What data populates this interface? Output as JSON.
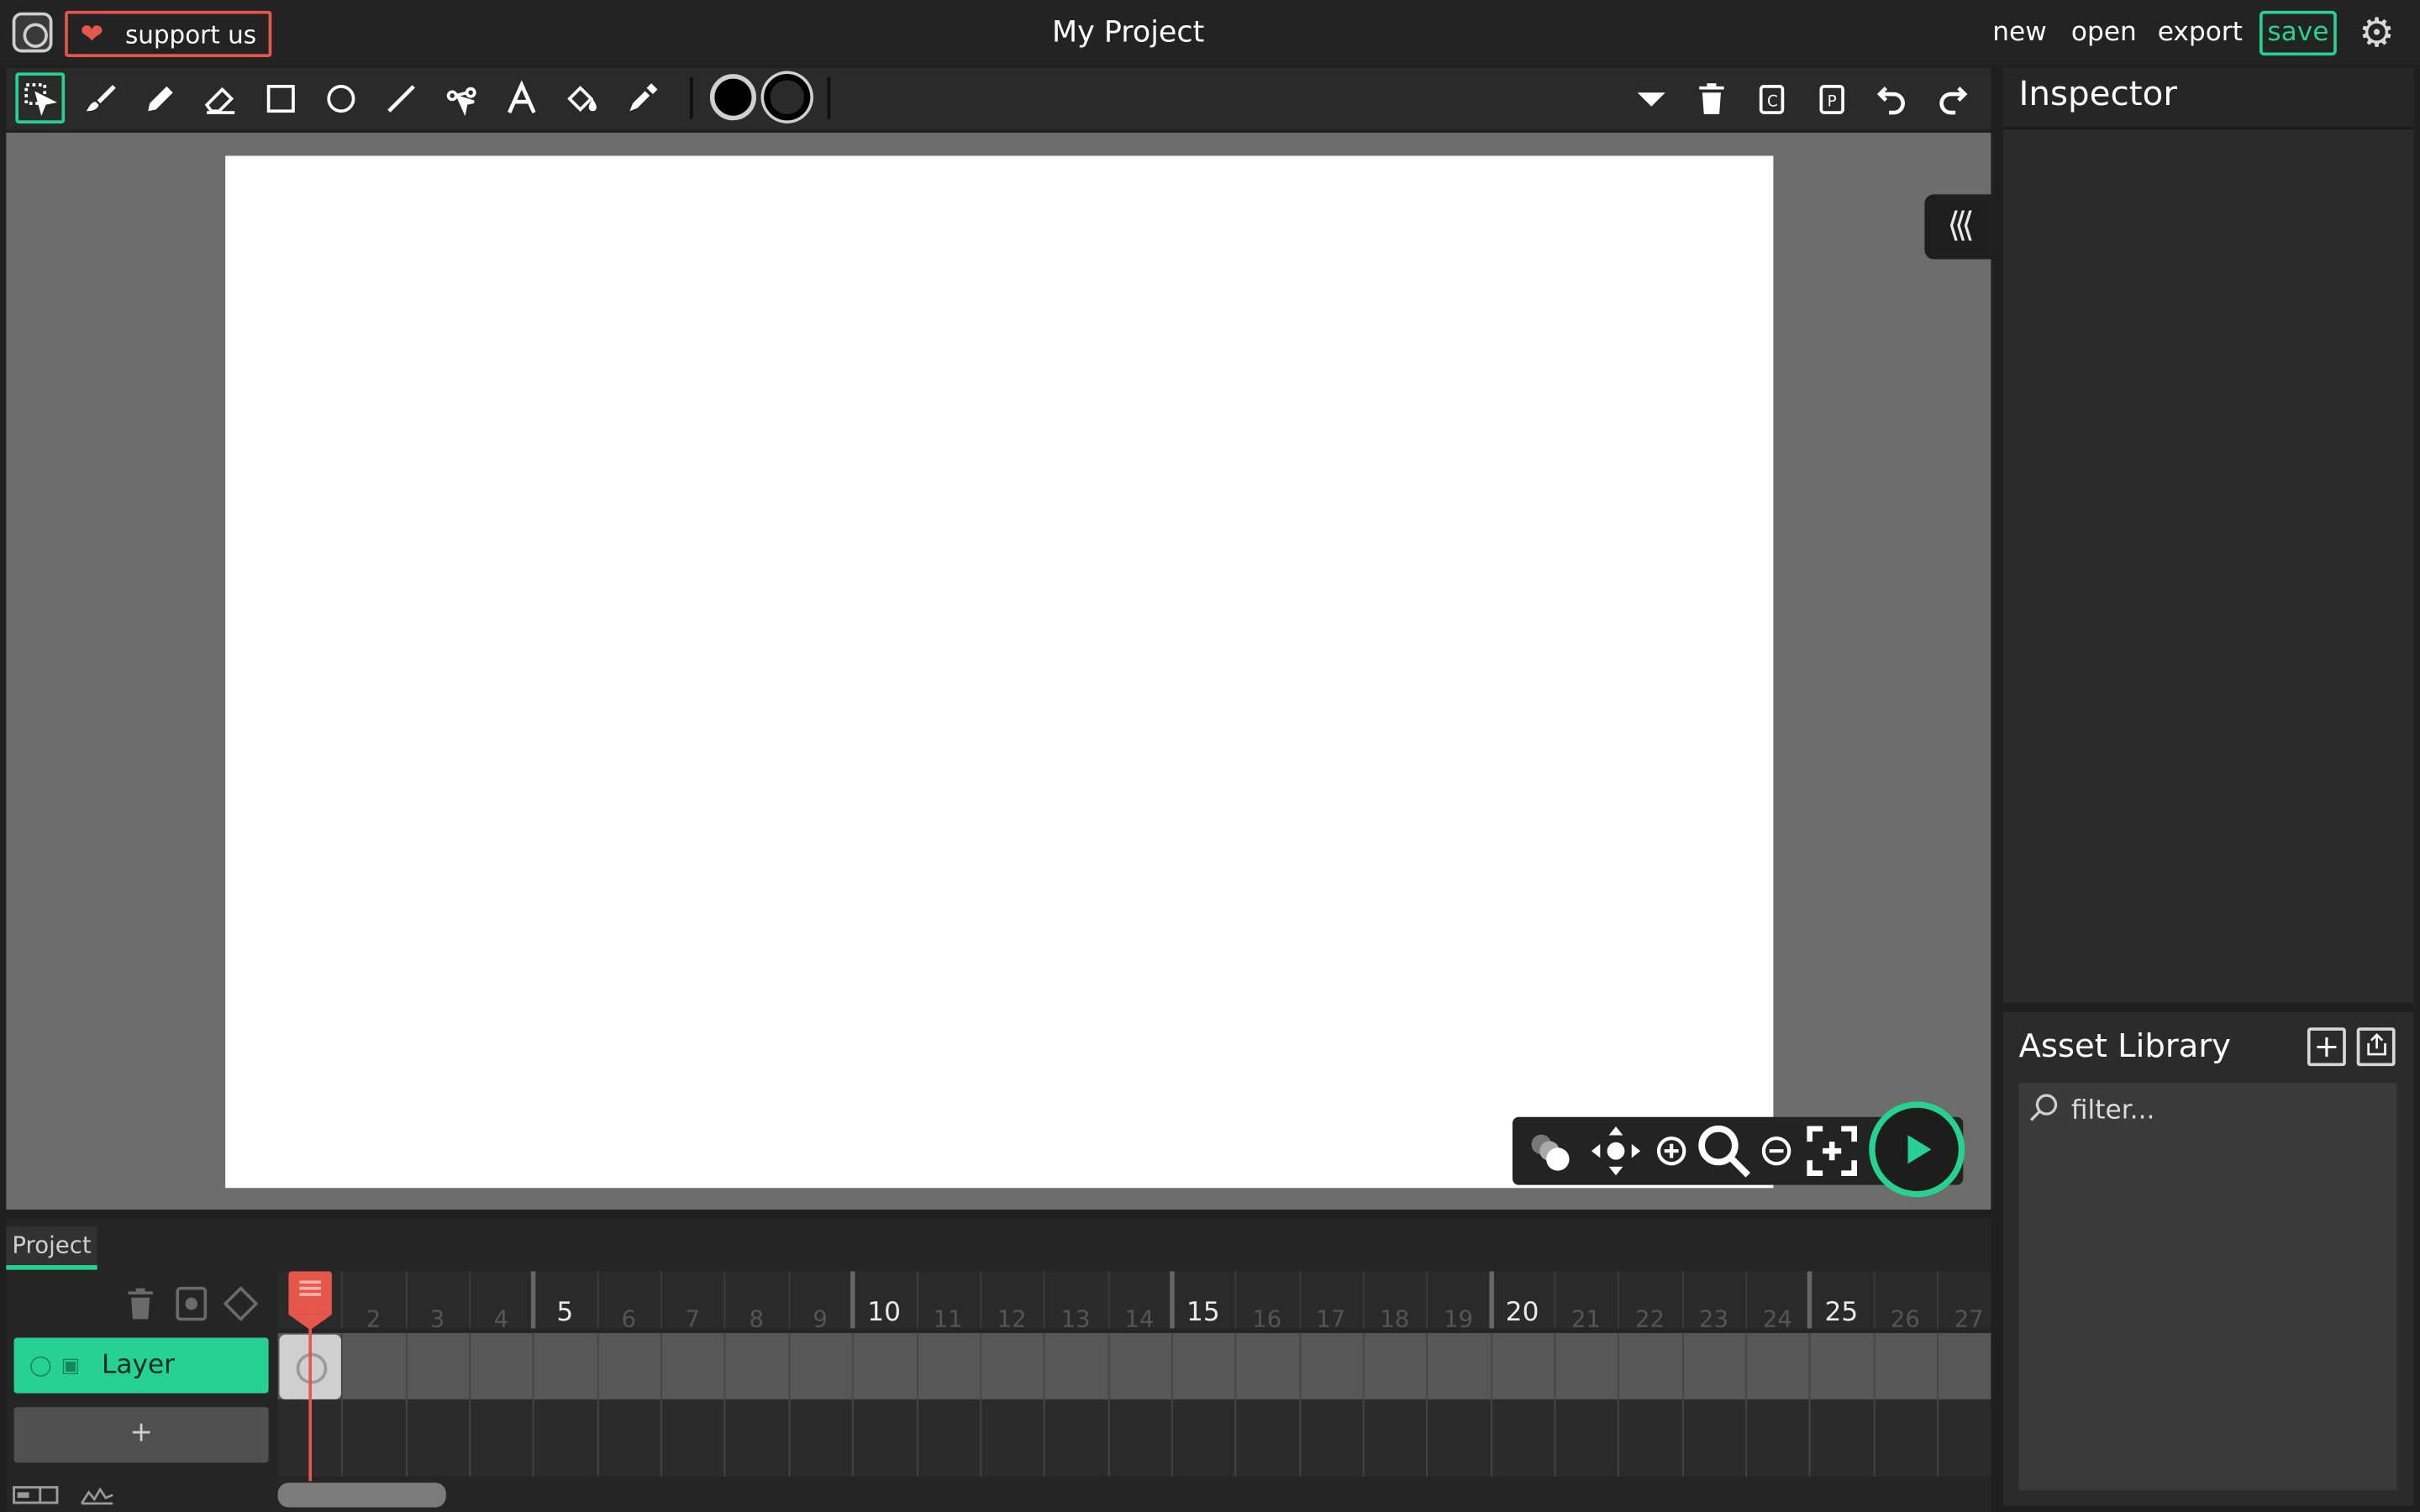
{
  "header": {
    "support_label": "support us",
    "project_title": "My Project",
    "menu": {
      "new": "new",
      "open": "open",
      "export": "export",
      "save": "save"
    }
  },
  "toolbar": {
    "tools": [
      "cursor-tool-icon",
      "brush-tool-icon",
      "pencil-tool-icon",
      "eraser-tool-icon",
      "rectangle-tool-icon",
      "ellipse-tool-icon",
      "line-tool-icon",
      "path-tool-icon",
      "text-tool-icon",
      "fill-tool-icon",
      "eyedropper-tool-icon"
    ],
    "fill_color": "#000000",
    "stroke_color": "#000000",
    "accent": "#27d095"
  },
  "inspector": {
    "title": "Inspector"
  },
  "asset_library": {
    "title": "Asset Library",
    "filter_placeholder": "filter..."
  },
  "timeline": {
    "tab_label": "Project",
    "layer_name": "Layer",
    "add_layer_label": "+",
    "frames_visible": [
      "2",
      "3",
      "4",
      "5",
      "6",
      "7",
      "8",
      "9",
      "10",
      "11",
      "12",
      "13",
      "14",
      "15",
      "16",
      "17",
      "18",
      "19",
      "20",
      "21",
      "22",
      "23",
      "24",
      "25",
      "26",
      "27"
    ],
    "major_frames": [
      "5",
      "10",
      "15",
      "20",
      "25"
    ],
    "current_frame": 1,
    "playhead_color": "#e4574a"
  }
}
